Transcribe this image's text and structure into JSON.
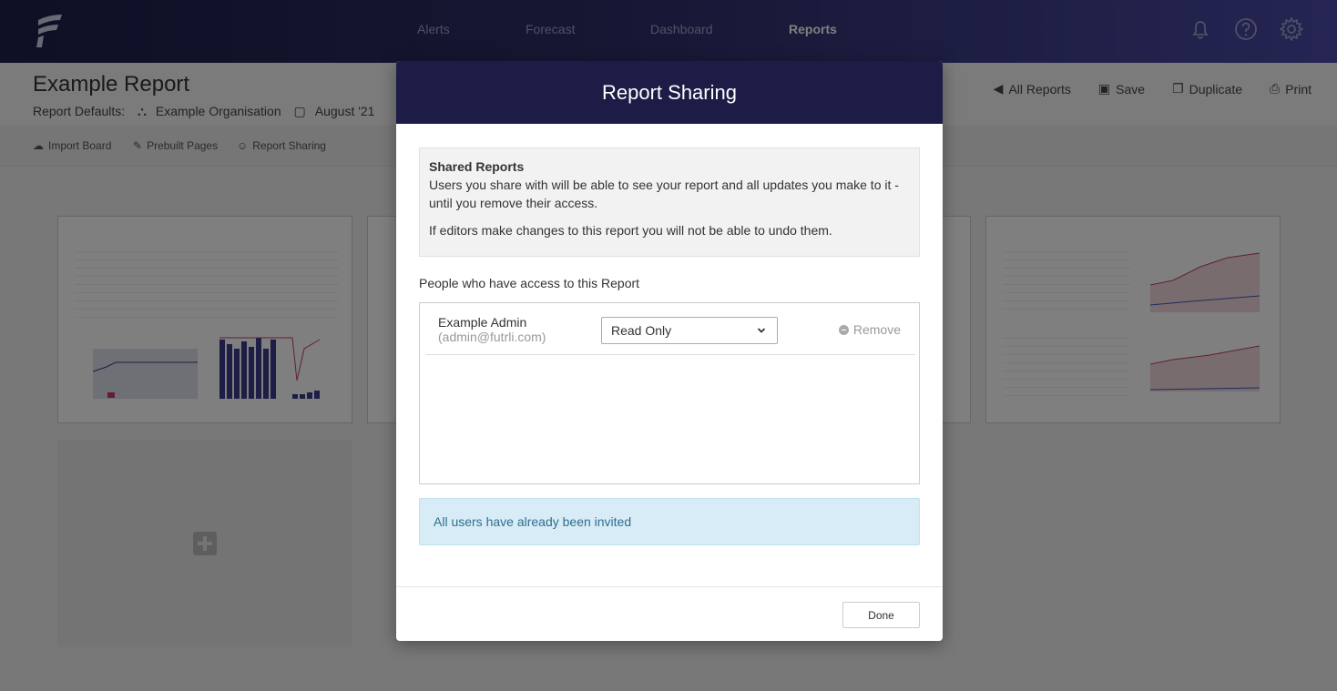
{
  "nav": {
    "items": [
      {
        "label": "Alerts",
        "active": false
      },
      {
        "label": "Forecast",
        "active": false
      },
      {
        "label": "Dashboard",
        "active": false
      },
      {
        "label": "Reports",
        "active": true
      }
    ],
    "icons": [
      "bell-icon",
      "help-icon",
      "gear-icon"
    ]
  },
  "header": {
    "title": "Example Report",
    "defaults_label": "Report Defaults:",
    "organisation": "Example Organisation",
    "month": "August '21",
    "actions": {
      "all_reports": "All Reports",
      "save": "Save",
      "duplicate": "Duplicate",
      "print": "Print"
    }
  },
  "subbar": {
    "import_board": "Import Board",
    "prebuilt_pages": "Prebuilt Pages",
    "report_sharing": "Report Sharing"
  },
  "modal": {
    "title": "Report Sharing",
    "info": {
      "title": "Shared Reports",
      "p1": "Users you share with will be able to see your report and all updates you make to it - until you remove their access.",
      "p2": "If editors make changes to this report you will not be able to undo them."
    },
    "access_label": "People who have access to this Report",
    "users": [
      {
        "name": "Example Admin",
        "email": "(admin@futrli.com)",
        "permission": "Read Only",
        "remove_label": "Remove"
      }
    ],
    "alert": "All users have already been invited",
    "done_label": "Done"
  },
  "colors": {
    "nav_dark": "#1e1f4a",
    "nav_light": "#4b4aa8",
    "modal_header": "#1c1c46",
    "alert_bg": "#d7ecf6"
  }
}
